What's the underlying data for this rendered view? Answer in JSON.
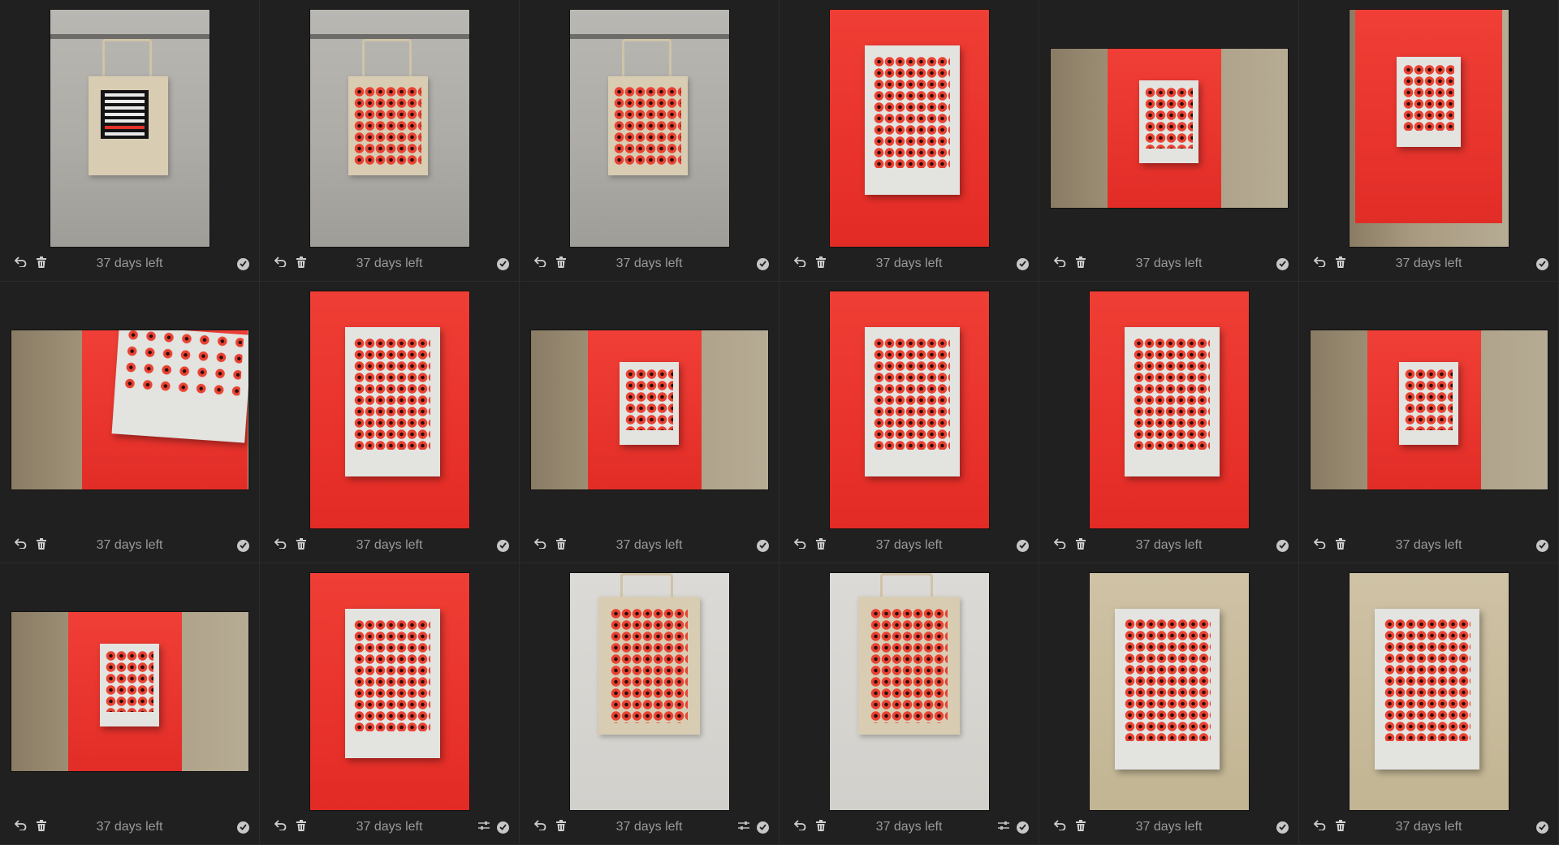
{
  "colors": {
    "background": "#1f1f1f",
    "poster_red": "#e32b25",
    "label_text": "#9a9a9a"
  },
  "tote_text": {
    "lines": [
      "NUMBER OF",
      "LAND AND",
      "ENVIRONMENTAL",
      "ACTIVISTS",
      "MURDERED IN",
      "COLOMBIA",
      "IN 2020"
    ],
    "highlight_line": "COLOMBIA"
  },
  "cells": [
    {
      "label": "37 days left",
      "orientation": "portrait",
      "scene": "bag-text",
      "icons": [
        "undo-icon",
        "trash-icon",
        "check-icon"
      ]
    },
    {
      "label": "37 days left",
      "orientation": "portrait",
      "scene": "bag-dots",
      "icons": [
        "undo-icon",
        "trash-icon",
        "check-icon"
      ]
    },
    {
      "label": "37 days left",
      "orientation": "portrait",
      "scene": "bag-dots",
      "icons": [
        "undo-icon",
        "trash-icon",
        "check-icon"
      ]
    },
    {
      "label": "37 days left",
      "orientation": "portrait",
      "scene": "poster-on-red",
      "icons": [
        "undo-icon",
        "trash-icon",
        "check-icon"
      ]
    },
    {
      "label": "37 days left",
      "orientation": "landscape",
      "scene": "red-panel-poster",
      "icons": [
        "undo-icon",
        "trash-icon",
        "check-icon"
      ]
    },
    {
      "label": "37 days left",
      "orientation": "portrait",
      "scene": "red-panel-poster",
      "icons": [
        "undo-icon",
        "trash-icon",
        "check-icon"
      ]
    },
    {
      "label": "37 days left",
      "orientation": "landscape",
      "scene": "poster-closeup",
      "icons": [
        "undo-icon",
        "trash-icon",
        "check-icon"
      ]
    },
    {
      "label": "37 days left",
      "orientation": "portrait",
      "scene": "poster-on-red",
      "icons": [
        "undo-icon",
        "trash-icon",
        "check-icon"
      ]
    },
    {
      "label": "37 days left",
      "orientation": "landscape",
      "scene": "red-panel-poster",
      "icons": [
        "undo-icon",
        "trash-icon",
        "check-icon"
      ]
    },
    {
      "label": "37 days left",
      "orientation": "portrait",
      "scene": "poster-on-red",
      "icons": [
        "undo-icon",
        "trash-icon",
        "check-icon"
      ]
    },
    {
      "label": "37 days left",
      "orientation": "portrait",
      "scene": "poster-on-red",
      "icons": [
        "undo-icon",
        "trash-icon",
        "check-icon"
      ]
    },
    {
      "label": "37 days left",
      "orientation": "landscape",
      "scene": "red-panel-poster",
      "icons": [
        "undo-icon",
        "trash-icon",
        "check-icon"
      ]
    },
    {
      "label": "37 days left",
      "orientation": "landscape",
      "scene": "red-panel-poster",
      "icons": [
        "undo-icon",
        "trash-icon",
        "check-icon"
      ]
    },
    {
      "label": "37 days left",
      "orientation": "portrait",
      "scene": "poster-on-red",
      "icons": [
        "undo-icon",
        "trash-icon",
        "sliders-icon",
        "check-icon"
      ]
    },
    {
      "label": "37 days left",
      "orientation": "portrait",
      "scene": "bag-on-white",
      "icons": [
        "undo-icon",
        "trash-icon",
        "sliders-icon",
        "check-icon"
      ]
    },
    {
      "label": "37 days left",
      "orientation": "portrait",
      "scene": "bag-on-white",
      "icons": [
        "undo-icon",
        "trash-icon",
        "sliders-icon",
        "check-icon"
      ]
    },
    {
      "label": "37 days left",
      "orientation": "portrait",
      "scene": "poster-on-beige",
      "icons": [
        "undo-icon",
        "trash-icon",
        "check-icon"
      ]
    },
    {
      "label": "37 days left",
      "orientation": "portrait",
      "scene": "poster-on-beige",
      "icons": [
        "undo-icon",
        "trash-icon",
        "check-icon"
      ]
    }
  ]
}
